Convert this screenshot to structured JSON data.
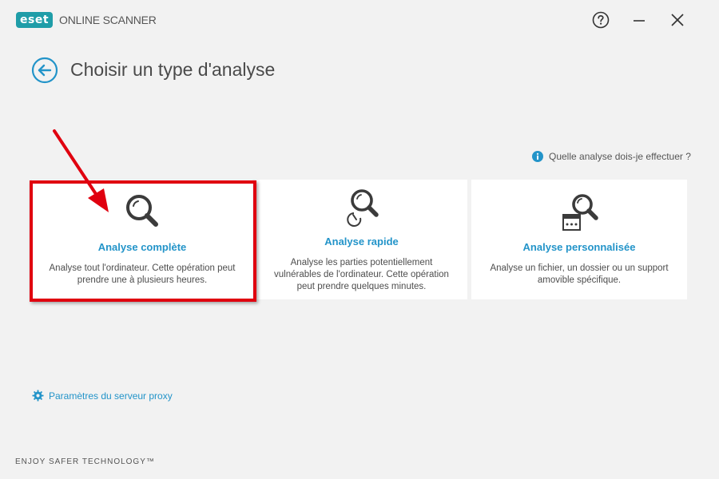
{
  "header": {
    "logo_text": "eset",
    "product_name": "ONLINE SCANNER"
  },
  "page": {
    "title": "Choisir un type d'analyse"
  },
  "help_link": {
    "label": "Quelle analyse dois-je effectuer ?"
  },
  "cards": [
    {
      "title": "Analyse complète",
      "description": "Analyse tout l'ordinateur. Cette opération peut prendre une à plusieurs heures.",
      "icon": "magnifier-icon"
    },
    {
      "title": "Analyse rapide",
      "description": "Analyse les parties potentiellement vulnérables de l'ordinateur. Cette opération peut prendre quelques minutes.",
      "icon": "quick-scan-icon"
    },
    {
      "title": "Analyse personnalisée",
      "description": "Analyse un fichier, un dossier ou un support amovible spécifique.",
      "icon": "custom-scan-icon"
    }
  ],
  "proxy_link": {
    "label": "Paramètres du serveur proxy"
  },
  "footer": {
    "tagline": "ENJOY SAFER TECHNOLOGY™"
  },
  "colors": {
    "accent": "#2394c9",
    "brand": "#1f9da8",
    "highlight": "#e0000f",
    "background": "#f2f2f2"
  }
}
